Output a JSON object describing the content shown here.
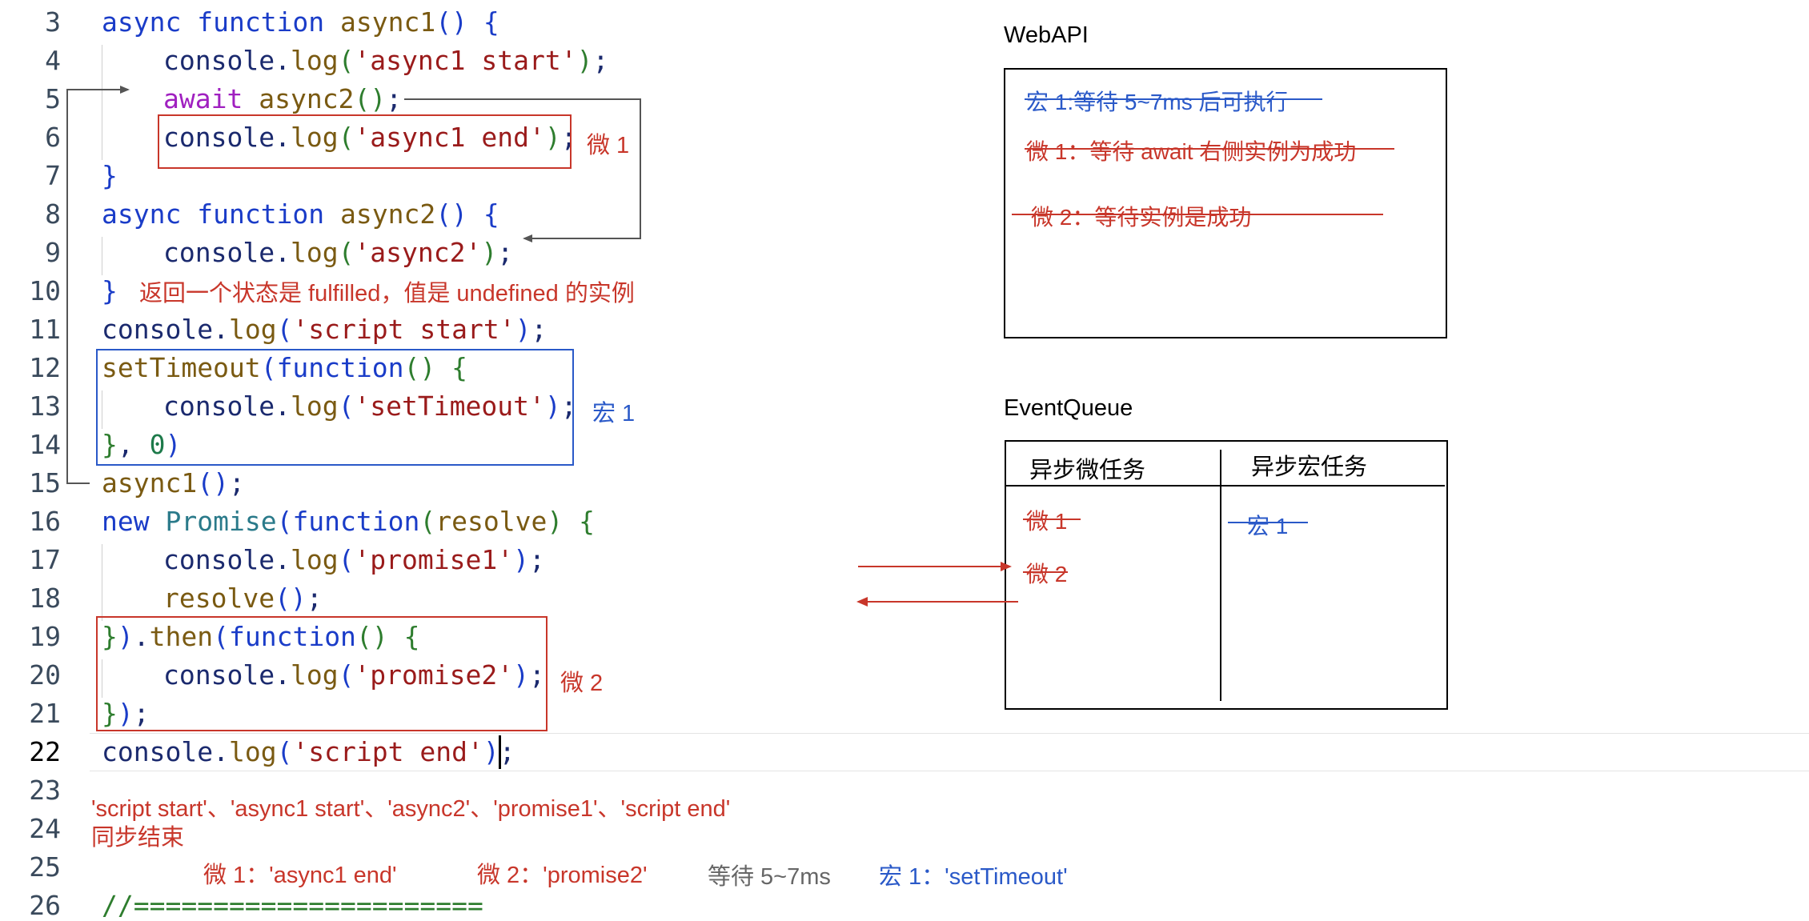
{
  "editor": {
    "line_numbers": [
      "3",
      "4",
      "5",
      "6",
      "7",
      "8",
      "9",
      "10",
      "11",
      "12",
      "13",
      "14",
      "15",
      "16",
      "17",
      "18",
      "19",
      "20",
      "21",
      "22",
      "23",
      "24",
      "25",
      "26"
    ],
    "code": {
      "l3": [
        "async",
        " ",
        "function",
        " ",
        "async1",
        "(",
        ")",
        " ",
        "{"
      ],
      "l4": [
        "console",
        ".",
        "log",
        "(",
        "'async1 start'",
        ")",
        ";"
      ],
      "l5": [
        "await",
        " ",
        "async2",
        "(",
        ")",
        ";"
      ],
      "l6": [
        "console",
        ".",
        "log",
        "(",
        "'async1 end'",
        ")",
        ";"
      ],
      "l7": [
        "}"
      ],
      "l8": [
        "async",
        " ",
        "function",
        " ",
        "async2",
        "(",
        ")",
        " ",
        "{"
      ],
      "l9": [
        "console",
        ".",
        "log",
        "(",
        "'async2'",
        ")",
        ";"
      ],
      "l10": [
        "}"
      ],
      "l11": [
        "console",
        ".",
        "log",
        "(",
        "'script start'",
        ")",
        ";"
      ],
      "l12": [
        "setTimeout",
        "(",
        "function",
        "(",
        ")",
        " ",
        "{"
      ],
      "l13": [
        "console",
        ".",
        "log",
        "(",
        "'setTimeout'",
        ")",
        ";"
      ],
      "l14": [
        "}",
        ",",
        " ",
        "0",
        ")"
      ],
      "l15": [
        "async1",
        "(",
        ")",
        ";"
      ],
      "l16": [
        "new",
        " ",
        "Promise",
        "(",
        "function",
        "(",
        "resolve",
        ")",
        " ",
        "{"
      ],
      "l17": [
        "console",
        ".",
        "log",
        "(",
        "'promise1'",
        ")",
        ";"
      ],
      "l18": [
        "resolve",
        "(",
        ")",
        ";"
      ],
      "l19": [
        "}",
        ")",
        ".",
        "then",
        "(",
        "function",
        "(",
        ")",
        " ",
        "{"
      ],
      "l20": [
        "console",
        ".",
        "log",
        "(",
        "'promise2'",
        ")",
        ";"
      ],
      "l21": [
        "}",
        ")",
        ";"
      ],
      "l22": [
        "console",
        ".",
        "log",
        "(",
        "'script end'",
        ")",
        ";"
      ],
      "l26": [
        "//======================"
      ]
    }
  },
  "annotations": {
    "micro1_label": "微 1",
    "macro1_label": "宏 1",
    "micro2_label": "微 2",
    "async2_note": "返回一个状态是 fulfilled，值是 undefined 的实例",
    "sync_output": "'script start'、'async1 start'、'async2'、'promise1'、'script end'",
    "sync_done": "同步结束",
    "order_micro1": "微 1：'async1 end'",
    "order_micro2": "微 2：'promise2'",
    "order_wait": "等待 5~7ms",
    "order_macro1": "宏 1：'setTimeout'"
  },
  "webapi": {
    "title": "WebAPI",
    "items": [
      "宏 1:等待 5~7ms 后可执行",
      "微 1：等待 await 右侧实例为成功",
      "微 2：等待实例是成功"
    ]
  },
  "eventqueue": {
    "title": "EventQueue",
    "col_micro": "异步微任务",
    "col_macro": "异步宏任务",
    "micro_items": [
      "微 1",
      "微 2"
    ],
    "macro_items": [
      "宏 1"
    ]
  },
  "colors": {
    "red": "#c8362a",
    "blue": "#2a59c8",
    "keyword": "#1a3cc8",
    "string": "#9a1b1b"
  }
}
